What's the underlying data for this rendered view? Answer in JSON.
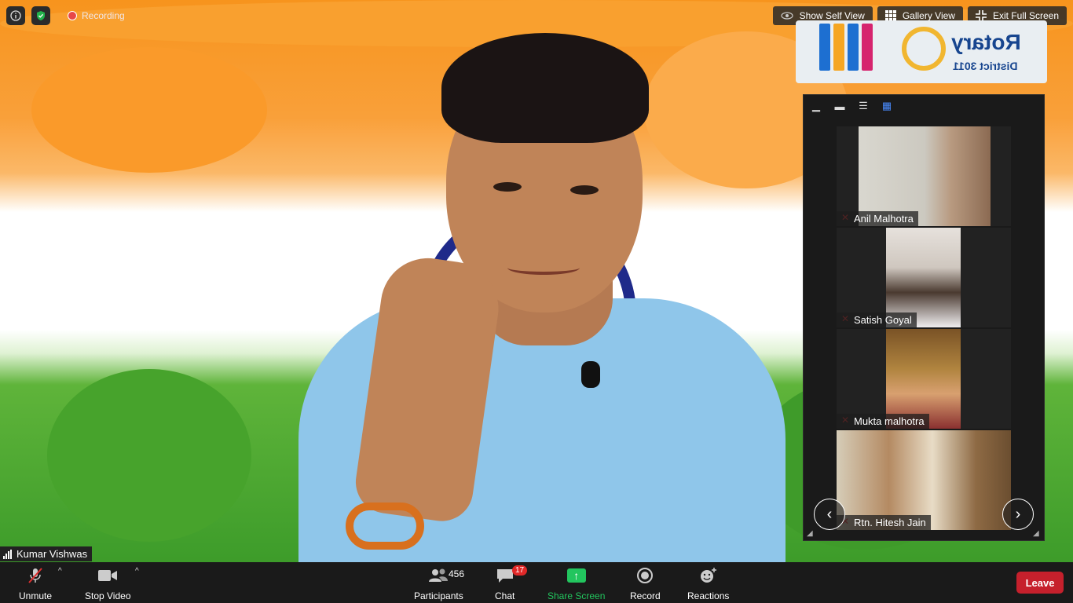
{
  "status": {
    "recording_label": "Recording"
  },
  "view_controls": {
    "show_self_view": "Show Self View",
    "gallery_view": "Gallery View",
    "exit_full_screen": "Exit Full Screen"
  },
  "overlay_logo": {
    "name": "Rotary",
    "district": "District 3011"
  },
  "active_speaker": {
    "name": "Kumar Vishwas"
  },
  "gallery": {
    "participants": [
      {
        "name": "Anil Malhotra",
        "muted": true
      },
      {
        "name": "Satish Goyal",
        "muted": true
      },
      {
        "name": "Mukta malhotra",
        "muted": true
      },
      {
        "name": "Rtn. Hitesh Jain",
        "muted": true
      }
    ]
  },
  "toolbar": {
    "unmute": "Unmute",
    "stop_video": "Stop Video",
    "participants": "Participants",
    "participants_count": "456",
    "chat": "Chat",
    "chat_badge": "17",
    "share_screen": "Share Screen",
    "record": "Record",
    "reactions": "Reactions",
    "leave": "Leave"
  },
  "colors": {
    "toolbar_bg": "#1a1a1a",
    "share_green": "#22c55e",
    "leave_red": "#c6202c",
    "recording_red": "#e84848"
  }
}
